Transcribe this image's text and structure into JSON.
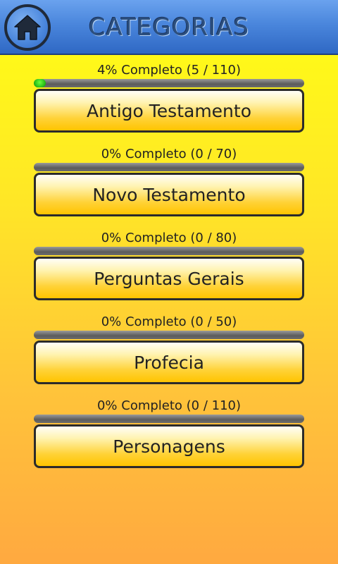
{
  "header": {
    "title": "CATEGORIAS",
    "home_icon": "home-icon"
  },
  "colors": {
    "topbar": "#4a86dc",
    "progress_fill": "#22b814",
    "button_accent": "#ffc400"
  },
  "categories": [
    {
      "label": "Antigo Testamento",
      "progress_text": "4% Completo (5 / 110)",
      "progress": 0.04
    },
    {
      "label": "Novo Testamento",
      "progress_text": "0% Completo (0 / 70)",
      "progress": 0
    },
    {
      "label": "Perguntas Gerais",
      "progress_text": "0% Completo (0 / 80)",
      "progress": 0
    },
    {
      "label": "Profecia",
      "progress_text": "0% Completo (0 / 50)",
      "progress": 0
    },
    {
      "label": "Personagens",
      "progress_text": "0% Completo (0 / 110)",
      "progress": 0
    }
  ]
}
